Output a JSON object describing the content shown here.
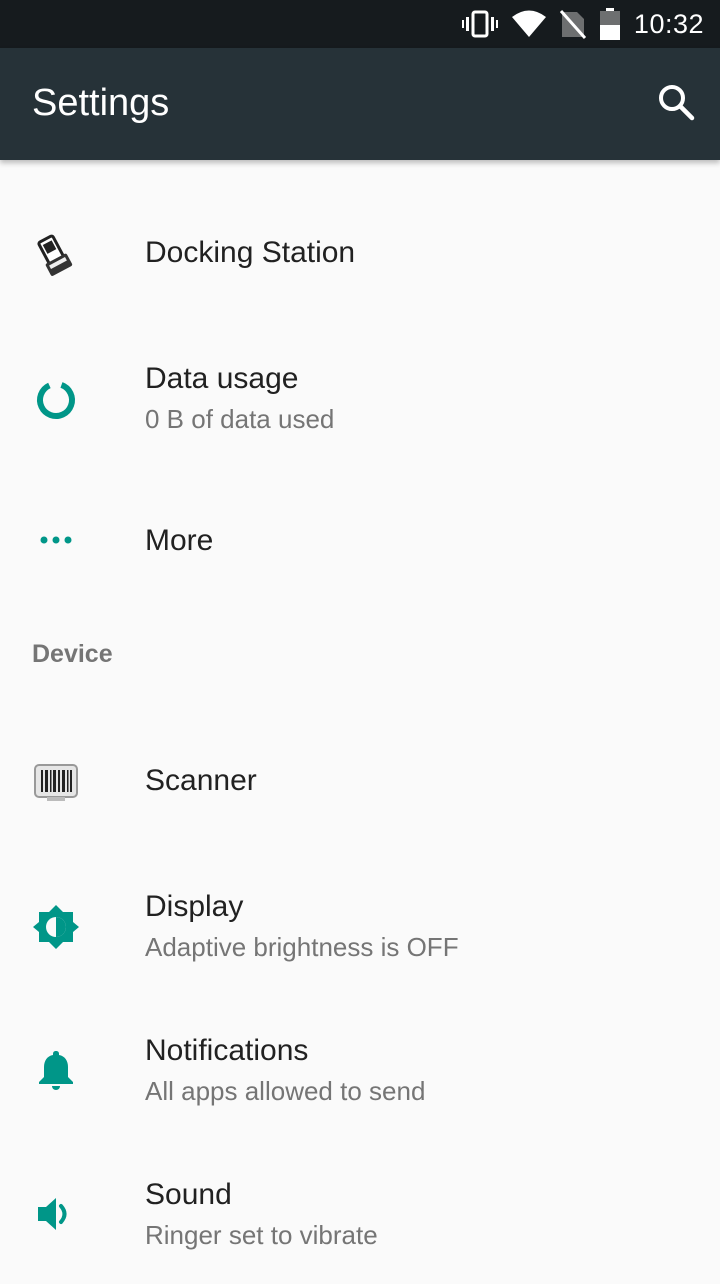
{
  "status_bar": {
    "time": "10:32",
    "icons": [
      "vibrate-icon",
      "wifi-icon",
      "no-sim-icon",
      "battery-icon"
    ]
  },
  "app_bar": {
    "title": "Settings",
    "search_icon": "search-icon"
  },
  "accent_color": "#009688",
  "items": [
    {
      "title": "Docking Station",
      "subtitle": "",
      "icon": "docking-station-icon"
    },
    {
      "title": "Data usage",
      "subtitle": "0 B of data used",
      "icon": "data-usage-icon"
    },
    {
      "title": "More",
      "subtitle": "",
      "icon": "more-dots-icon"
    }
  ],
  "section_device": "Device",
  "device_items": [
    {
      "title": "Scanner",
      "subtitle": "",
      "icon": "barcode-scanner-icon"
    },
    {
      "title": "Display",
      "subtitle": "Adaptive brightness is OFF",
      "icon": "brightness-icon"
    },
    {
      "title": "Notifications",
      "subtitle": "All apps allowed to send",
      "icon": "bell-icon"
    },
    {
      "title": "Sound",
      "subtitle": "Ringer set to vibrate",
      "icon": "speaker-icon"
    }
  ]
}
